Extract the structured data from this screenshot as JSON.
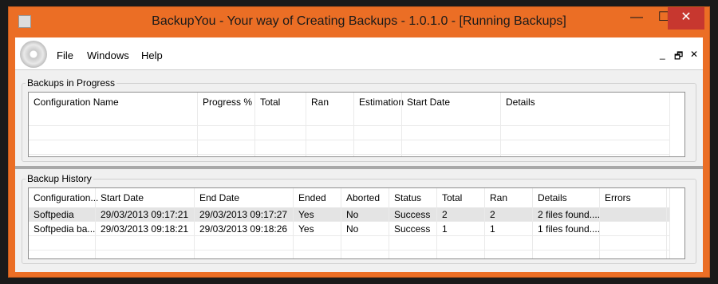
{
  "window": {
    "title": "BackupYou - Your way of Creating Backups - 1.0.1.0 - [Running Backups]",
    "minimize_glyph": "—",
    "maximize_glyph": "☐",
    "close_glyph": "✕"
  },
  "menu": {
    "file": "File",
    "windows": "Windows",
    "help": "Help",
    "mdi_minimize": "_",
    "mdi_restore": "🗗",
    "mdi_close": "✕"
  },
  "in_progress": {
    "title": "Backups in Progress",
    "columns": [
      "Configuration Name",
      "Progress %",
      "Total",
      "Ran",
      "Estimation",
      "Start Date",
      "Details"
    ]
  },
  "history": {
    "title": "Backup History",
    "columns": [
      "Configuration...",
      "Start Date",
      "End Date",
      "Ended",
      "Aborted",
      "Status",
      "Total",
      "Ran",
      "Details",
      "Errors"
    ],
    "rows": [
      [
        "Softpedia",
        "29/03/2013 09:17:21",
        "29/03/2013 09:17:27",
        "Yes",
        "No",
        "Success",
        "2",
        "2",
        "2 files found....",
        ""
      ],
      [
        "Softpedia ba...",
        "29/03/2013 09:18:21",
        "29/03/2013 09:18:26",
        "Yes",
        "No",
        "Success",
        "1",
        "1",
        "1 files found....",
        ""
      ]
    ]
  },
  "colors": {
    "title_bar": "#eb6e25",
    "close_button": "#c7372f",
    "selected_row": "#e4e4e4"
  }
}
